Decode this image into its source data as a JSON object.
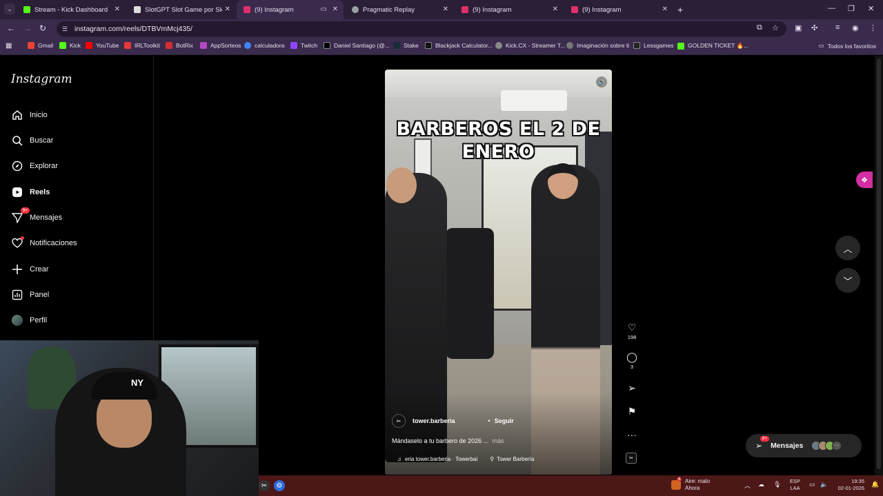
{
  "browser": {
    "tabs": [
      {
        "title": "Stream - Kick Dashboard",
        "favicon_color": "#53fc18"
      },
      {
        "title": "SlotGPT Slot Game por SlotGPT",
        "favicon_color": "#ffffff"
      },
      {
        "title": "(9) Instagram",
        "favicon_color": "#e1306c",
        "active": true
      },
      {
        "title": "Pragmatic Replay",
        "favicon_color": "#9aa0a6"
      },
      {
        "title": "(9) Instagram",
        "favicon_color": "#e1306c"
      },
      {
        "title": "(9) Instagram",
        "favicon_color": "#e1306c"
      }
    ],
    "url": "instagram.com/reels/DTBVmMcj435/",
    "bookmarks": [
      {
        "label": "Gmail",
        "color": "#ea4335"
      },
      {
        "label": "Kick",
        "color": "#53fc18"
      },
      {
        "label": "YouTube",
        "color": "#ff0000"
      },
      {
        "label": "IRLToolkit",
        "color": "#e53935"
      },
      {
        "label": "BotRix",
        "color": "#d32f2f"
      },
      {
        "label": "AppSorteos",
        "color": "#b548c6"
      },
      {
        "label": "calculadora",
        "color": "#4285f4"
      },
      {
        "label": "Twitch",
        "color": "#9146ff"
      },
      {
        "label": "Daniel Santiago (@...",
        "color": "#000000"
      },
      {
        "label": "Stake",
        "color": "#1a2c38"
      },
      {
        "label": "Blackjack Calculator...",
        "color": "#111111"
      },
      {
        "label": "Kick.CX - Streamer T...",
        "color": "#888888"
      },
      {
        "label": "Imaginación sobre ti",
        "color": "#777777"
      },
      {
        "label": "Lessgames",
        "color": "#222222"
      },
      {
        "label": "GOLDEN TICKET 🔥...",
        "color": "#53fc18"
      }
    ],
    "all_bookmarks_label": "Todos los favoritos"
  },
  "instagram": {
    "logo": "Instagram",
    "nav": [
      {
        "label": "Inicio",
        "icon": "home-icon"
      },
      {
        "label": "Buscar",
        "icon": "search-icon"
      },
      {
        "label": "Explorar",
        "icon": "explore-icon"
      },
      {
        "label": "Reels",
        "icon": "reels-icon",
        "active": true
      },
      {
        "label": "Mensajes",
        "icon": "messages-icon",
        "badge": "9+"
      },
      {
        "label": "Notificaciones",
        "icon": "heart-icon",
        "dot": true
      },
      {
        "label": "Crear",
        "icon": "plus-icon"
      },
      {
        "label": "Panel",
        "icon": "dashboard-icon"
      },
      {
        "label": "Perfil",
        "icon": "profile-icon"
      }
    ],
    "reel": {
      "caption_overlay": "BARBEROS EL 2 DE ENERO",
      "author": "tower.barberia",
      "separator": "•",
      "follow_label": "Seguir",
      "description": "Mándaselo a tu barbero de 2026 ...",
      "more_label": "más",
      "audio": "eria  tower.barberia · Towerbai",
      "location": "Tower Barbería",
      "likes": "198",
      "comments": "3"
    },
    "messages_pill": {
      "label": "Mensajes",
      "badge": "9+"
    }
  },
  "taskbar": {
    "weather_badge": "6",
    "weather_line1": "Aire: malo",
    "weather_line2": "Ahora",
    "lang_line1": "ESP",
    "lang_line2": "LAA",
    "time": "19:35",
    "date": "02-01-2026"
  }
}
